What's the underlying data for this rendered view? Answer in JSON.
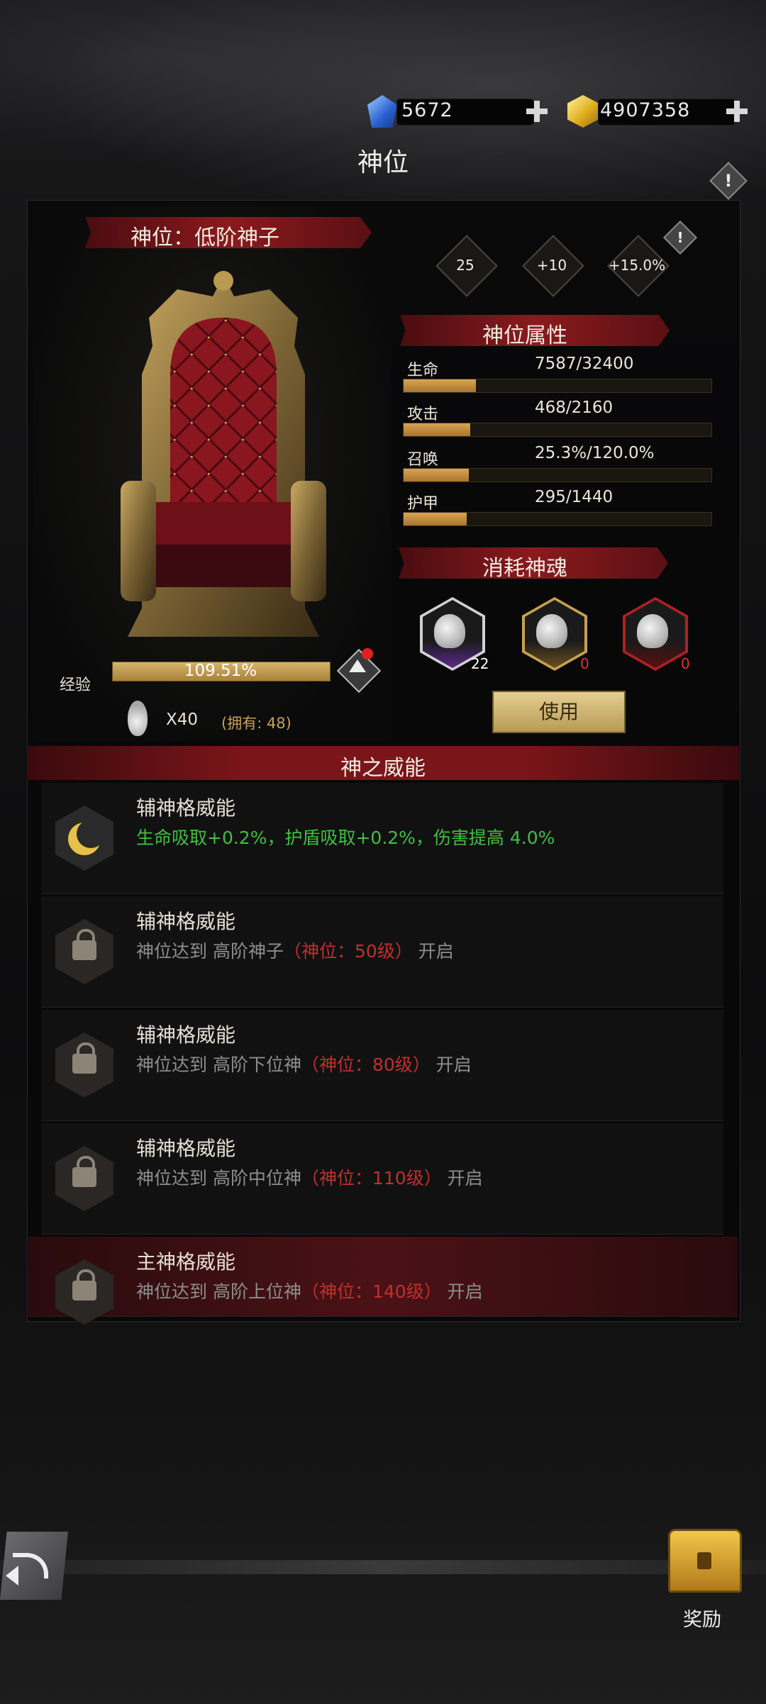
{
  "header": {
    "gems": "5672",
    "gold": "4907358",
    "title": "神位",
    "info_mark": "!"
  },
  "rank_panel": {
    "banner": "神位：低阶神子",
    "diamonds": [
      "25",
      "+10",
      "+15.0%"
    ],
    "info_mark": "!",
    "exp_label": "经验",
    "exp_value": "109.51%",
    "exp_progress": 1.0,
    "soul_cost": "X40",
    "owned": "(拥有: 48)"
  },
  "attributes": {
    "title": "神位属性",
    "stats": [
      {
        "label": "生命",
        "value": "7587/32400",
        "progress": 0.234
      },
      {
        "label": "攻击",
        "value": "468/2160",
        "progress": 0.217
      },
      {
        "label": "召唤",
        "value": "25.3%/120.0%",
        "progress": 0.211
      },
      {
        "label": "护甲",
        "value": "295/1440",
        "progress": 0.205
      }
    ]
  },
  "souls": {
    "title": "消耗神魂",
    "items": [
      {
        "count": "22",
        "tier": "purple"
      },
      {
        "count": "0",
        "tier": "gold"
      },
      {
        "count": "0",
        "tier": "red"
      }
    ],
    "use_button": "使用"
  },
  "powers": {
    "title": "神之威能",
    "rows": [
      {
        "title": "辅神格威能",
        "desc": "生命吸取+0.2%，护盾吸取+0.2%，伤害提高 4.0%",
        "unlocked": true
      },
      {
        "title": "辅神格威能",
        "prefix": "神位达到",
        "rank": "高阶神子",
        "req": "（神位：50级）",
        "suffix": "开启"
      },
      {
        "title": "辅神格威能",
        "prefix": "神位达到",
        "rank": "高阶下位神",
        "req": "（神位：80级）",
        "suffix": "开启"
      },
      {
        "title": "辅神格威能",
        "prefix": "神位达到",
        "rank": "高阶中位神",
        "req": "（神位：110级）",
        "suffix": "开启"
      },
      {
        "title": "主神格威能",
        "prefix": "神位达到",
        "rank": "高阶上位神",
        "req": "（神位：140级）",
        "suffix": "开启"
      }
    ]
  },
  "footer": {
    "reward_label": "奖励"
  },
  "colors": {
    "accent_gold": "#d9a454",
    "banner_red": "#8a1a1e",
    "req_red": "#c0302c",
    "bonus_green": "#3fbf3f"
  }
}
